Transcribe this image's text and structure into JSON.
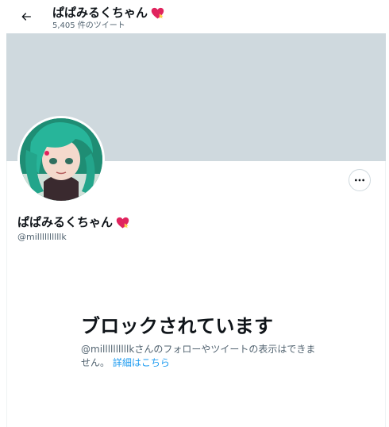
{
  "header": {
    "title": "ぱぱみるくちゃん",
    "tweet_count": "5,405 件のツイート",
    "back_icon": "arrow-left-icon"
  },
  "profile": {
    "display_name": "ぱぱみるくちゃん",
    "handle": "@millllllllllk",
    "name_emoji": "heart-with-ribbon-icon",
    "banner_color": "#cfd9de",
    "more_icon": "ellipsis-icon"
  },
  "blocked": {
    "title": "ブロックされています",
    "description": "@millllllllllkさんのフォローやツイートの表示はできません。",
    "learn_more": "詳細はこちら",
    "link_color": "#1d9bf0"
  }
}
